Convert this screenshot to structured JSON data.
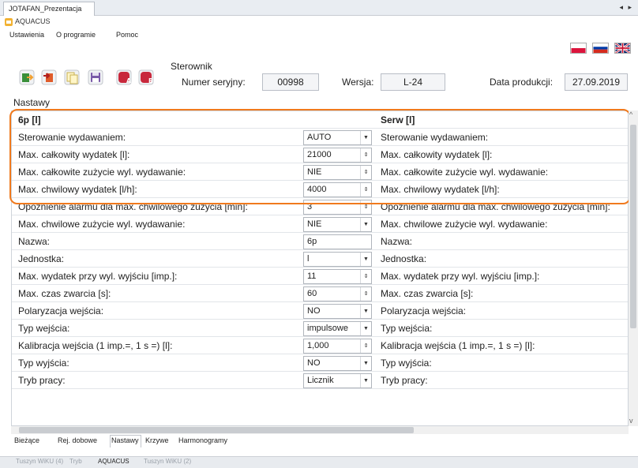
{
  "doc_tab": {
    "label": "JOTAFAN_Prezentacja",
    "nav": "◂ ▸"
  },
  "app": {
    "title": "AQUACUS"
  },
  "menu": [
    "Ustawienia",
    "O programie",
    "Pomoc"
  ],
  "flags": [
    {
      "name": "polish-flag",
      "colors": [
        "#ffffff",
        "#dc143c"
      ]
    },
    {
      "name": "russian-flag",
      "colors": [
        "#ffffff",
        "#0039a6",
        "#d52b1e"
      ]
    },
    {
      "name": "english-flag",
      "colors": [
        "#012169",
        "#c8102e",
        "#ffffff"
      ]
    }
  ],
  "toolbar": [
    {
      "icon": "import-icon",
      "color": "#3a8f3a"
    },
    {
      "icon": "export-icon",
      "color": "#e05c2a"
    },
    {
      "icon": "copy-icon",
      "color": "#d8c66a"
    },
    {
      "icon": "save-icon",
      "color": "#7a5aa8"
    },
    {
      "icon": "program-a-icon",
      "color": "#c8283c"
    },
    {
      "icon": "program-b-icon",
      "color": "#c8283c"
    }
  ],
  "device": {
    "group_label": "Sterownik",
    "serial_label": "Numer seryjny:",
    "serial_value": "00998",
    "version_label": "Wersja:",
    "version_value": "L-24",
    "date_label": "Data produkcji:",
    "date_value": "27.09.2019"
  },
  "section_label": "Nastawy",
  "grid": {
    "header_left": "6p  [l]",
    "header_right": "Serw  [l]",
    "rows": [
      {
        "label": "Sterowanie wydawaniem:",
        "value": "AUTO",
        "control": "dropdown",
        "right": "Sterowanie wydawaniem:"
      },
      {
        "label": "Max. całkowity wydatek [l]:",
        "value": "21000",
        "control": "spinner",
        "right": "Max. całkowity wydatek [l]:"
      },
      {
        "label": "Max. całkowite zużycie wyl. wydawanie:",
        "value": "NIE",
        "control": "spinner",
        "right": "Max. całkowite zużycie wyl. wydawanie:"
      },
      {
        "label": "Max. chwilowy wydatek [l/h]:",
        "value": "4000",
        "control": "spinner",
        "right": "Max. chwilowy wydatek [l/h]:"
      },
      {
        "label": "Opóźnienie alarmu dla max. chwilowego zużycia [min]:",
        "value": "3",
        "control": "spinner",
        "right": "Opóźnienie alarmu dla max. chwilowego zużycia [min]:"
      },
      {
        "label": "Max. chwilowe zużycie wyl. wydawanie:",
        "value": "NIE",
        "control": "dropdown",
        "right": "Max. chwilowe zużycie wyl. wydawanie:"
      },
      {
        "label": "Nazwa:",
        "value": "6p",
        "control": "text",
        "right": "Nazwa:"
      },
      {
        "label": "Jednostka:",
        "value": "l",
        "control": "dropdown",
        "right": "Jednostka:"
      },
      {
        "label": "Max. wydatek przy wyl. wyjściu [imp.]:",
        "value": "11",
        "control": "spinner",
        "right": "Max. wydatek przy wyl. wyjściu [imp.]:"
      },
      {
        "label": "Max. czas zwarcia [s]:",
        "value": "60",
        "control": "spinner",
        "right": "Max. czas zwarcia [s]:"
      },
      {
        "label": "Polaryzacja wejścia:",
        "value": "NO",
        "control": "dropdown",
        "right": "Polaryzacja wejścia:"
      },
      {
        "label": "Typ wejścia:",
        "value": "impulsowe",
        "control": "dropdown",
        "right": "Typ wejścia:"
      },
      {
        "label": "Kalibracja wejścia (1 imp.=, 1 s =) [l]:",
        "value": "1,000",
        "control": "spinner",
        "right": "Kalibracja wejścia (1 imp.=, 1 s =) [l]:"
      },
      {
        "label": "Typ wyjścia:",
        "value": "NO",
        "control": "dropdown",
        "right": "Typ wyjścia:"
      },
      {
        "label": "Tryb pracy:",
        "value": "Licznik",
        "control": "dropdown",
        "right": "Tryb pracy:"
      }
    ]
  },
  "bottom_tabs": [
    "Bieżące",
    "Rej. dobowe",
    "Nastawy",
    "Krzywe",
    "Harmonogramy"
  ],
  "active_bottom_tab": "Nastawy",
  "highlight_color": "#f07a1e",
  "taskbar": [
    "Tuszyn WiKU (4)",
    "Tryb",
    "AQUACUS",
    "Tuszyn WiKU (2)"
  ]
}
